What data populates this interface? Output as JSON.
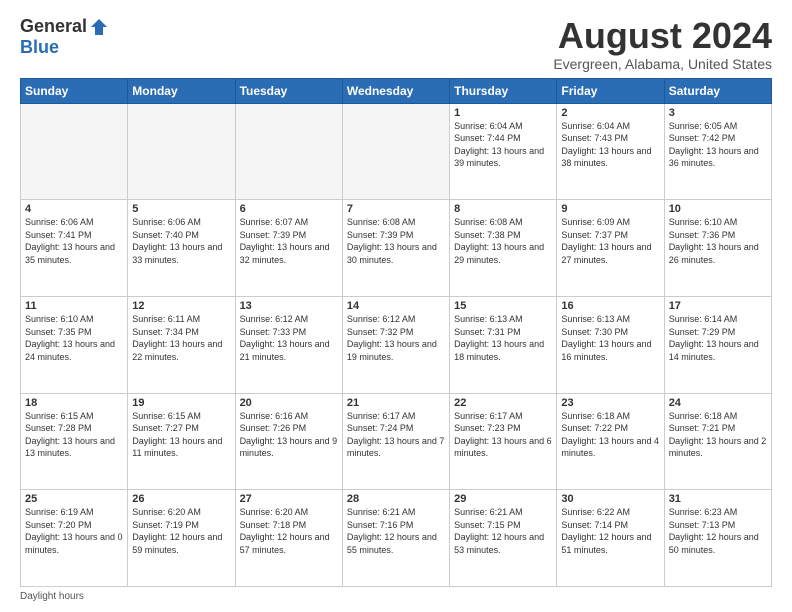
{
  "logo": {
    "general": "General",
    "blue": "Blue"
  },
  "title": "August 2024",
  "subtitle": "Evergreen, Alabama, United States",
  "days_of_week": [
    "Sunday",
    "Monday",
    "Tuesday",
    "Wednesday",
    "Thursday",
    "Friday",
    "Saturday"
  ],
  "footer": "Daylight hours",
  "weeks": [
    [
      {
        "day": "",
        "sunrise": "",
        "sunset": "",
        "daylight": "",
        "empty": true
      },
      {
        "day": "",
        "sunrise": "",
        "sunset": "",
        "daylight": "",
        "empty": true
      },
      {
        "day": "",
        "sunrise": "",
        "sunset": "",
        "daylight": "",
        "empty": true
      },
      {
        "day": "",
        "sunrise": "",
        "sunset": "",
        "daylight": "",
        "empty": true
      },
      {
        "day": "1",
        "sunrise": "6:04 AM",
        "sunset": "7:44 PM",
        "daylight": "13 hours and 39 minutes."
      },
      {
        "day": "2",
        "sunrise": "6:04 AM",
        "sunset": "7:43 PM",
        "daylight": "13 hours and 38 minutes."
      },
      {
        "day": "3",
        "sunrise": "6:05 AM",
        "sunset": "7:42 PM",
        "daylight": "13 hours and 36 minutes."
      }
    ],
    [
      {
        "day": "4",
        "sunrise": "6:06 AM",
        "sunset": "7:41 PM",
        "daylight": "13 hours and 35 minutes."
      },
      {
        "day": "5",
        "sunrise": "6:06 AM",
        "sunset": "7:40 PM",
        "daylight": "13 hours and 33 minutes."
      },
      {
        "day": "6",
        "sunrise": "6:07 AM",
        "sunset": "7:39 PM",
        "daylight": "13 hours and 32 minutes."
      },
      {
        "day": "7",
        "sunrise": "6:08 AM",
        "sunset": "7:39 PM",
        "daylight": "13 hours and 30 minutes."
      },
      {
        "day": "8",
        "sunrise": "6:08 AM",
        "sunset": "7:38 PM",
        "daylight": "13 hours and 29 minutes."
      },
      {
        "day": "9",
        "sunrise": "6:09 AM",
        "sunset": "7:37 PM",
        "daylight": "13 hours and 27 minutes."
      },
      {
        "day": "10",
        "sunrise": "6:10 AM",
        "sunset": "7:36 PM",
        "daylight": "13 hours and 26 minutes."
      }
    ],
    [
      {
        "day": "11",
        "sunrise": "6:10 AM",
        "sunset": "7:35 PM",
        "daylight": "13 hours and 24 minutes."
      },
      {
        "day": "12",
        "sunrise": "6:11 AM",
        "sunset": "7:34 PM",
        "daylight": "13 hours and 22 minutes."
      },
      {
        "day": "13",
        "sunrise": "6:12 AM",
        "sunset": "7:33 PM",
        "daylight": "13 hours and 21 minutes."
      },
      {
        "day": "14",
        "sunrise": "6:12 AM",
        "sunset": "7:32 PM",
        "daylight": "13 hours and 19 minutes."
      },
      {
        "day": "15",
        "sunrise": "6:13 AM",
        "sunset": "7:31 PM",
        "daylight": "13 hours and 18 minutes."
      },
      {
        "day": "16",
        "sunrise": "6:13 AM",
        "sunset": "7:30 PM",
        "daylight": "13 hours and 16 minutes."
      },
      {
        "day": "17",
        "sunrise": "6:14 AM",
        "sunset": "7:29 PM",
        "daylight": "13 hours and 14 minutes."
      }
    ],
    [
      {
        "day": "18",
        "sunrise": "6:15 AM",
        "sunset": "7:28 PM",
        "daylight": "13 hours and 13 minutes."
      },
      {
        "day": "19",
        "sunrise": "6:15 AM",
        "sunset": "7:27 PM",
        "daylight": "13 hours and 11 minutes."
      },
      {
        "day": "20",
        "sunrise": "6:16 AM",
        "sunset": "7:26 PM",
        "daylight": "13 hours and 9 minutes."
      },
      {
        "day": "21",
        "sunrise": "6:17 AM",
        "sunset": "7:24 PM",
        "daylight": "13 hours and 7 minutes."
      },
      {
        "day": "22",
        "sunrise": "6:17 AM",
        "sunset": "7:23 PM",
        "daylight": "13 hours and 6 minutes."
      },
      {
        "day": "23",
        "sunrise": "6:18 AM",
        "sunset": "7:22 PM",
        "daylight": "13 hours and 4 minutes."
      },
      {
        "day": "24",
        "sunrise": "6:18 AM",
        "sunset": "7:21 PM",
        "daylight": "13 hours and 2 minutes."
      }
    ],
    [
      {
        "day": "25",
        "sunrise": "6:19 AM",
        "sunset": "7:20 PM",
        "daylight": "13 hours and 0 minutes."
      },
      {
        "day": "26",
        "sunrise": "6:20 AM",
        "sunset": "7:19 PM",
        "daylight": "12 hours and 59 minutes."
      },
      {
        "day": "27",
        "sunrise": "6:20 AM",
        "sunset": "7:18 PM",
        "daylight": "12 hours and 57 minutes."
      },
      {
        "day": "28",
        "sunrise": "6:21 AM",
        "sunset": "7:16 PM",
        "daylight": "12 hours and 55 minutes."
      },
      {
        "day": "29",
        "sunrise": "6:21 AM",
        "sunset": "7:15 PM",
        "daylight": "12 hours and 53 minutes."
      },
      {
        "day": "30",
        "sunrise": "6:22 AM",
        "sunset": "7:14 PM",
        "daylight": "12 hours and 51 minutes."
      },
      {
        "day": "31",
        "sunrise": "6:23 AM",
        "sunset": "7:13 PM",
        "daylight": "12 hours and 50 minutes."
      }
    ]
  ]
}
